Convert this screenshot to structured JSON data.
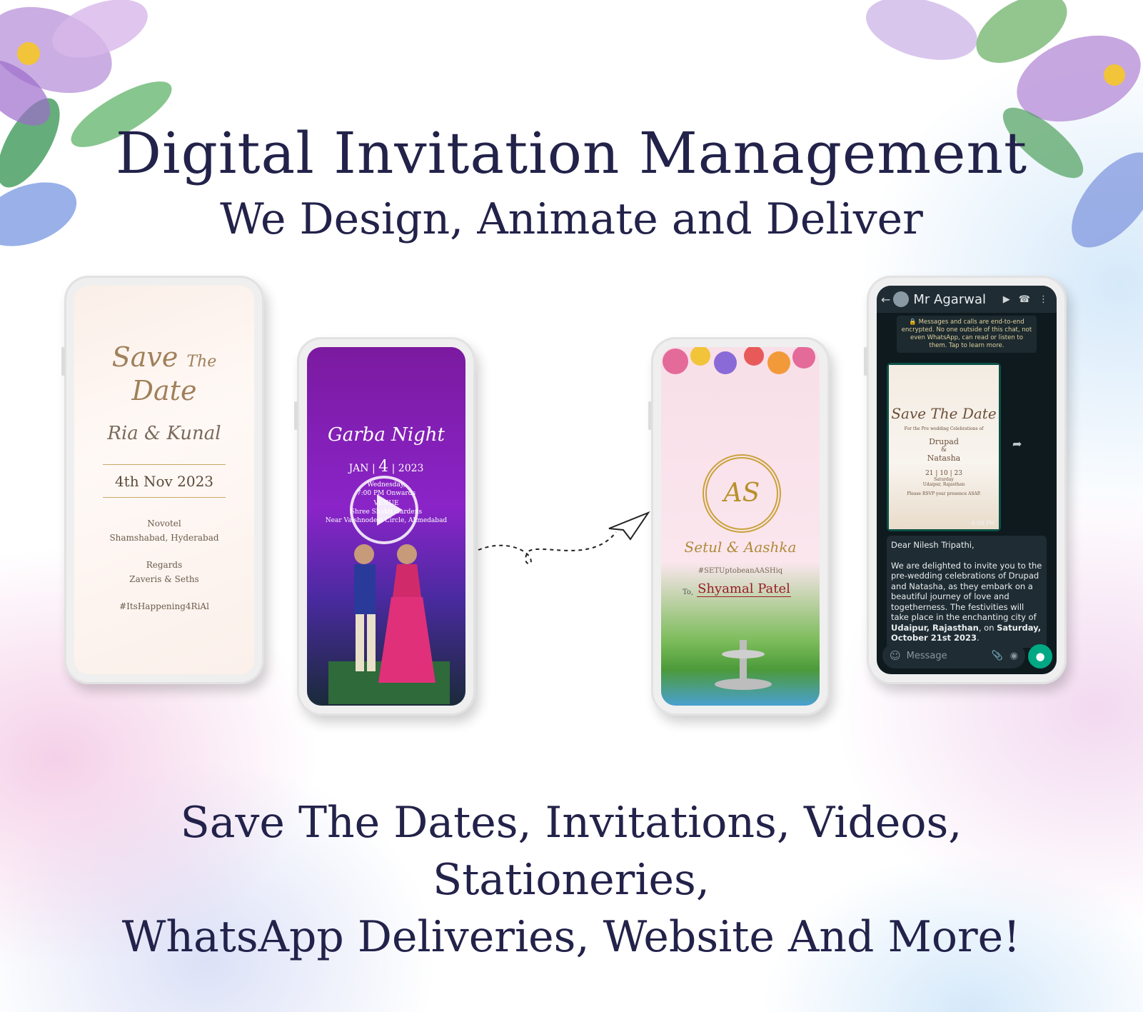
{
  "header": {
    "title": "Digital Invitation Management",
    "subtitle": "We Design, Animate and Deliver"
  },
  "phone1": {
    "save": "Save",
    "the": "The",
    "date_word": "Date",
    "names": "Ria & Kunal",
    "date": "4th Nov 2023",
    "venue": "Novotel",
    "city": "Shamshabad, Hyderabad",
    "regards": "Regards",
    "families": "Zaveris & Seths",
    "hashtag": "#ItsHappening4RiAl"
  },
  "phone2": {
    "title": "Garba Night",
    "month": "JAN",
    "day": "4",
    "year": "2023",
    "weekday": "Wednesday,",
    "time": "7:00 PM Onwards",
    "venue_label": "VENUE",
    "venue": "Shree Shakti Gardens",
    "address": "Near Vaishnodevi Circle, Ahmedabad"
  },
  "phone3": {
    "monogram": "AS",
    "couple": "Setul & Aashka",
    "hashtag": "#SETUptobeanAASHiq",
    "to_label": "To,",
    "guest": "Shyamal Patel"
  },
  "phone4": {
    "contact": "Mr Agarwal",
    "encryption": "Messages and calls are end-to-end encrypted. No one outside of this chat, not even WhatsApp, can read or listen to them.",
    "learn_more": "Tap to learn more.",
    "card_title": "Save The Date",
    "card_sub": "For the Pre wedding Celebrations of",
    "card_name1": "Drupad",
    "card_amp": "&",
    "card_name2": "Natasha",
    "card_date": "21 | 10 | 23",
    "card_day": "Saturday",
    "card_place": "Udaipur, Rajasthan",
    "card_rsvp": "Please RSVP your presence ASAP.",
    "card_time": "6:06 PM",
    "greeting": "Dear Nilesh Tripathi,",
    "body_start": "We are delighted to invite you to the pre-wedding celebrations of Drupad and Natasha, as they embark on a beautiful journey of love and togetherness. The festivities will take place in the enchanting city of ",
    "body_place": "Udaipur, Rajasthan",
    "body_mid": ", on ",
    "body_date": "Saturday, October 21st 2023",
    "body_end": ".",
    "input_placeholder": "Message"
  },
  "footer": {
    "line1": "Save The Dates, Invitations, Videos, Stationeries,",
    "line2": "WhatsApp Deliveries, Website And More!"
  },
  "colors": {
    "heading": "#22224a",
    "whatsapp_green": "#00a884",
    "whatsapp_bg": "#0e1a1e"
  }
}
